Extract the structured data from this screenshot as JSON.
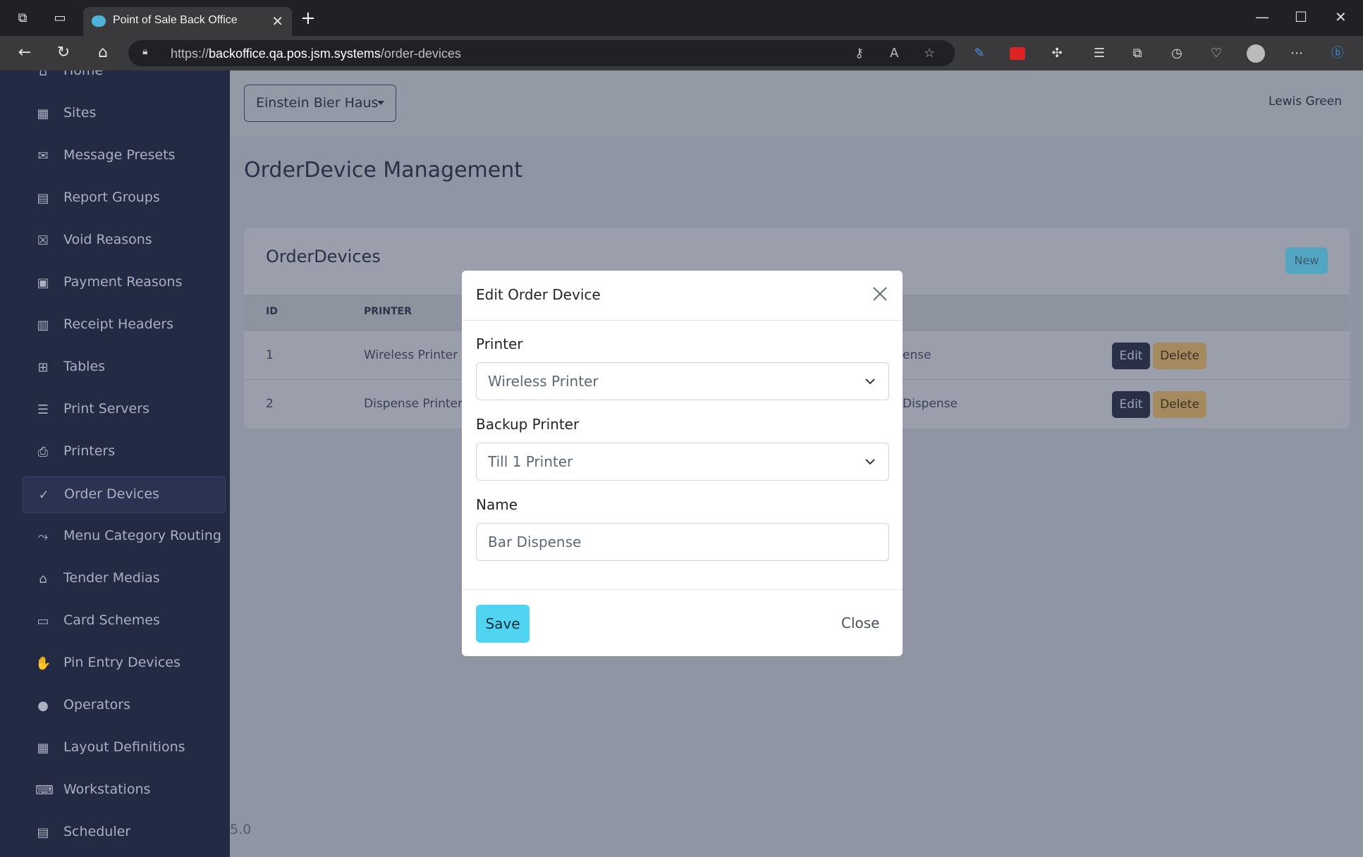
{
  "browser": {
    "tab_title": "Point of Sale Back Office",
    "url_prefix": "https://",
    "url_host": "backoffice.qa.pos.jsm.systems",
    "url_path": "/order-devices"
  },
  "sidebar": {
    "items": [
      {
        "label": "Home",
        "icon": "home-icon"
      },
      {
        "label": "Sites",
        "icon": "building-icon"
      },
      {
        "label": "Message Presets",
        "icon": "envelope-icon"
      },
      {
        "label": "Report Groups",
        "icon": "report-icon"
      },
      {
        "label": "Void Reasons",
        "icon": "x-square-icon"
      },
      {
        "label": "Payment Reasons",
        "icon": "money-icon"
      },
      {
        "label": "Receipt Headers",
        "icon": "receipt-icon"
      },
      {
        "label": "Tables",
        "icon": "table-icon"
      },
      {
        "label": "Print Servers",
        "icon": "server-icon"
      },
      {
        "label": "Printers",
        "icon": "printer-icon"
      },
      {
        "label": "Order Devices",
        "icon": "check-icon",
        "active": true
      },
      {
        "label": "Menu Category Routing",
        "icon": "route-icon"
      },
      {
        "label": "Tender Medias",
        "icon": "bank-icon"
      },
      {
        "label": "Card Schemes",
        "icon": "credit-card-icon"
      },
      {
        "label": "Pin Entry Devices",
        "icon": "pin-pad-icon"
      },
      {
        "label": "Operators",
        "icon": "user-icon"
      },
      {
        "label": "Layout Definitions",
        "icon": "grid-icon"
      },
      {
        "label": "Workstations",
        "icon": "keyboard-icon"
      },
      {
        "label": "Scheduler",
        "icon": "clipboard-icon"
      }
    ]
  },
  "header": {
    "site_selector": "Einstein Bier Haus",
    "user_name": "Lewis Green"
  },
  "main": {
    "page_title": "OrderDevice Management",
    "card_title": "OrderDevices",
    "new_label": "New",
    "columns": [
      "ID",
      "PRINTER"
    ],
    "rows": [
      {
        "id": "1",
        "printer": "Wireless Printer",
        "name_fragment": "ense",
        "edit": "Edit",
        "delete": "Delete"
      },
      {
        "id": "2",
        "printer": "Dispense Printer",
        "name_fragment": "Dispense",
        "edit": "Edit",
        "delete": "Delete"
      }
    ],
    "version": "5.0"
  },
  "modal": {
    "title": "Edit Order Device",
    "printer_label": "Printer",
    "printer_value": "Wireless Printer",
    "backup_label": "Backup Printer",
    "backup_value": "Till 1 Printer",
    "name_label": "Name",
    "name_value": "Bar Dispense",
    "save_label": "Save",
    "close_label": "Close"
  }
}
